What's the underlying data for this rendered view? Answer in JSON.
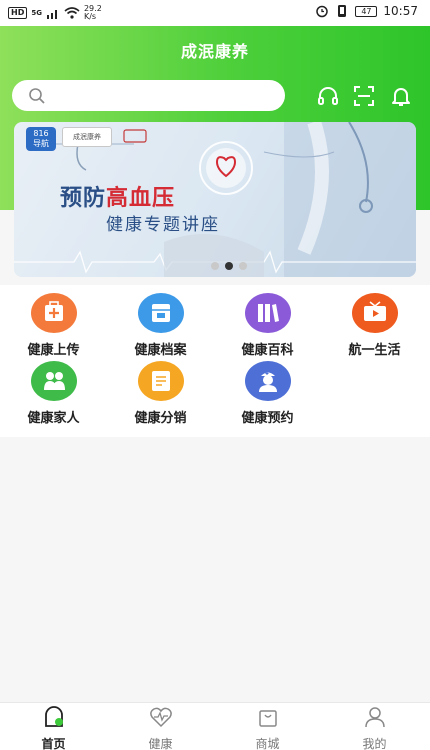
{
  "status_bar": {
    "hd": "HD",
    "signal_label": "5G",
    "net_speed_value": "29.2",
    "net_speed_unit": "K/s",
    "battery": "47",
    "time": "10:57"
  },
  "header": {
    "title": "成泯康养",
    "search_placeholder": ""
  },
  "banner": {
    "badge_816": "816",
    "badge_816_sub": "导航",
    "logo_text": "成泯康养",
    "line1_prefix": "预防",
    "line1_highlight": "高血压",
    "line2": "健康专题讲座",
    "slide_count": 3,
    "active_index": 1
  },
  "grid": [
    {
      "label": "健康上传",
      "icon": "medkit-icon",
      "color": "#f47a3c"
    },
    {
      "label": "健康档案",
      "icon": "archive-box-icon",
      "color": "#3d9ae8"
    },
    {
      "label": "健康百科",
      "icon": "books-icon",
      "color": "#8a5ad8"
    },
    {
      "label": "航一生活",
      "icon": "tv-play-icon",
      "color": "#ef5a1e"
    },
    {
      "label": "健康家人",
      "icon": "family-icon",
      "color": "#3fbb4a"
    },
    {
      "label": "健康分销",
      "icon": "document-icon",
      "color": "#f5a623"
    },
    {
      "label": "健康预约",
      "icon": "nurse-icon",
      "color": "#4d6fd6"
    }
  ],
  "tabs": [
    {
      "label": "首页",
      "icon": "home-icon",
      "active": true
    },
    {
      "label": "健康",
      "icon": "heart-pulse-icon",
      "active": false
    },
    {
      "label": "商城",
      "icon": "shopping-bag-icon",
      "active": false
    },
    {
      "label": "我的",
      "icon": "user-icon",
      "active": false
    }
  ],
  "colors": {
    "brand_green": "#3ec93a",
    "tab_active": "#222222"
  }
}
